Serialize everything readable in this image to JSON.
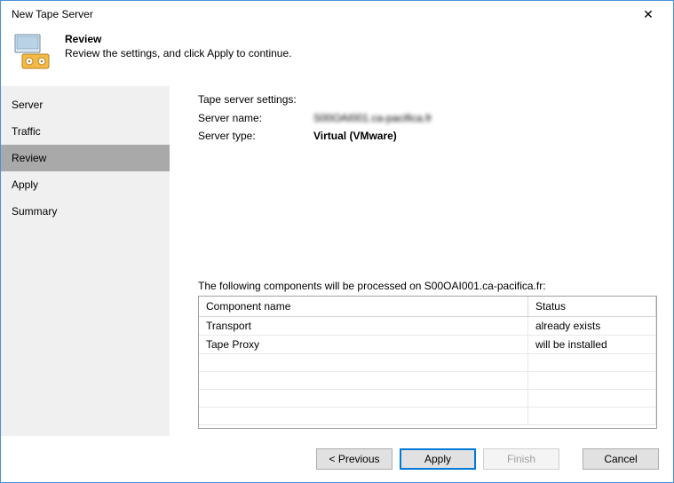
{
  "window": {
    "title": "New Tape Server"
  },
  "header": {
    "heading": "Review",
    "subheading": "Review the settings, and click Apply to continue."
  },
  "sidebar": {
    "items": [
      {
        "label": "Server"
      },
      {
        "label": "Traffic"
      },
      {
        "label": "Review",
        "selected": true
      },
      {
        "label": "Apply"
      },
      {
        "label": "Summary"
      }
    ]
  },
  "main": {
    "settings_title": "Tape server settings:",
    "server_name_label": "Server name:",
    "server_name_value": "S00OAI001.ca-pacifica.fr",
    "server_type_label": "Server type:",
    "server_type_value": "Virtual (VMware)",
    "components_label": "The following components will be processed on S00OAI001.ca-pacifica.fr:",
    "table": {
      "col_component": "Component name",
      "col_status": "Status",
      "rows": [
        {
          "name": "Transport",
          "status": "already exists"
        },
        {
          "name": "Tape Proxy",
          "status": "will be installed"
        }
      ]
    }
  },
  "footer": {
    "previous": "< Previous",
    "apply": "Apply",
    "finish": "Finish",
    "cancel": "Cancel"
  }
}
